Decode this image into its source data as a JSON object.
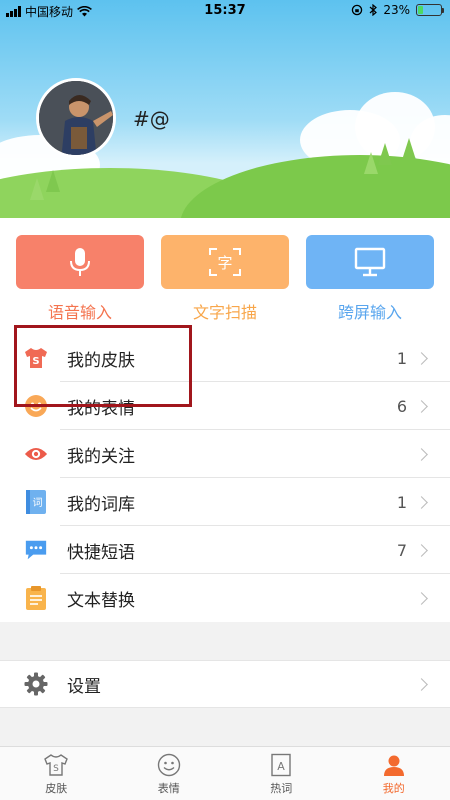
{
  "status_bar": {
    "carrier": "中国移动",
    "time": "15:37",
    "battery": "23%",
    "battery_level": 0.23
  },
  "profile": {
    "username": "#@"
  },
  "features": [
    {
      "label": "语音输入",
      "icon": "microphone-icon",
      "color": "#f7816a",
      "label_color": "#f4744f"
    },
    {
      "label": "文字扫描",
      "icon": "scan-text-icon",
      "color": "#fdb36b",
      "label_color": "#f8a64a"
    },
    {
      "label": "跨屏输入",
      "icon": "monitor-icon",
      "color": "#6fb4f5",
      "label_color": "#5aa6ee"
    }
  ],
  "menu": [
    {
      "label": "我的皮肤",
      "count": "1",
      "icon": "shirt-icon"
    },
    {
      "label": "我的表情",
      "count": "6",
      "icon": "smiley-icon"
    },
    {
      "label": "我的关注",
      "count": "",
      "icon": "eye-icon"
    },
    {
      "label": "我的词库",
      "count": "1",
      "icon": "dictionary-icon"
    },
    {
      "label": "快捷短语",
      "count": "7",
      "icon": "chat-bubble-icon"
    },
    {
      "label": "文本替换",
      "count": "",
      "icon": "clipboard-icon"
    }
  ],
  "settings": {
    "label": "设置",
    "icon": "gear-icon"
  },
  "tabs": [
    {
      "label": "皮肤",
      "icon": "shirt-tab-icon",
      "active": false
    },
    {
      "label": "表情",
      "icon": "smiley-tab-icon",
      "active": false
    },
    {
      "label": "热词",
      "icon": "hotword-tab-icon",
      "active": false
    },
    {
      "label": "我的",
      "icon": "profile-tab-icon",
      "active": true
    }
  ],
  "colors": {
    "accent": "#f36a2e",
    "highlight_box": "#a1161c"
  }
}
